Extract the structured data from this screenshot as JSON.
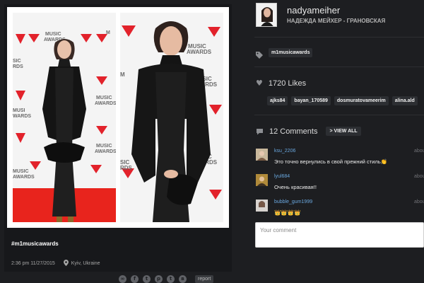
{
  "post": {
    "hashtag": "#m1musicawards",
    "date": "2:36 pm 11/27/2015",
    "location": "Kyiv, Ukraine",
    "report_label": "report",
    "share_icons": [
      "link-icon",
      "facebook-icon",
      "twitter-icon",
      "pinterest-icon",
      "tumblr-icon",
      "vk-icon"
    ],
    "backdrop_text": [
      "MUSIC",
      "AWARDS"
    ]
  },
  "profile": {
    "username": "nadyameiher",
    "full_name": "НАДЕЖДА МЕЙХЕР - ГРАНОВСКАЯ"
  },
  "tags": [
    "m1musicawards"
  ],
  "likes": {
    "label": "1720 Likes",
    "users": [
      "ajks84",
      "bayan_170589",
      "dosmuratovameerim",
      "alina.ald"
    ]
  },
  "comments": {
    "label": "12 Comments",
    "view_all": "> VIEW ALL",
    "items": [
      {
        "user": "ksu_2206",
        "text": "Это точно вернулись в свой прежний стиль👏",
        "time": "abou"
      },
      {
        "user": "lyul684",
        "text": "Очень красивая!!",
        "time": "abou"
      },
      {
        "user": "bubble_gum1999",
        "text": "👑👑👑👑",
        "time": "abou"
      }
    ],
    "input_placeholder": "Your comment"
  },
  "colors": {
    "background": "#1d1e21",
    "accent_red": "#e2222b",
    "username_blue": "#6aa8e0",
    "chip": "#2c2e32"
  }
}
